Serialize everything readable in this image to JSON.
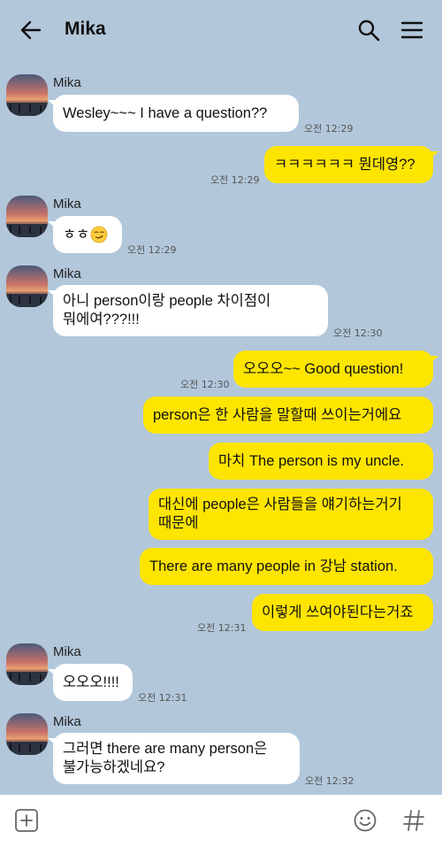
{
  "header": {
    "title": "Mika"
  },
  "messages": [
    {
      "sender": "Mika",
      "text": "Wesley~~~ I have a question??",
      "time": "오전 12:29"
    },
    {
      "text": "ㅋㅋㅋㅋㅋㅋ 뭔데영??",
      "time": "오전 12:29"
    },
    {
      "sender": "Mika",
      "text": "ㅎㅎ",
      "time": "오전 12:29",
      "emoji": "smirk-face"
    },
    {
      "sender": "Mika",
      "line1": "아니 person이랑 people 차이점이",
      "line2": "뭐에여???!!!",
      "time": "오전 12:30"
    },
    {
      "text": "오오오~~ Good question!",
      "time": "오전 12:30"
    },
    {
      "text": "person은 한 사람을 말할때 쓰이는거에요"
    },
    {
      "text": "마치 The person is my uncle."
    },
    {
      "line1": "대신에 people은 사람들을 얘기하는거기",
      "line2": "때문에"
    },
    {
      "text": "There are many people in 강남 station."
    },
    {
      "text": "이렇게 쓰여야된다는거죠",
      "time": "오전 12:31"
    },
    {
      "sender": "Mika",
      "text": "오오오!!!!",
      "time": "오전 12:31"
    },
    {
      "sender": "Mika",
      "line1": "그러면 there are many person은",
      "line2": "불가능하겠네요?",
      "time": "오전 12:32"
    }
  ],
  "colors": {
    "background": "#b2c7da",
    "outgoing": "#fee500",
    "incoming": "#ffffff"
  },
  "icons": [
    "back-arrow-icon",
    "search-icon",
    "menu-icon",
    "add-icon",
    "emoji-icon",
    "hashtag-icon"
  ]
}
